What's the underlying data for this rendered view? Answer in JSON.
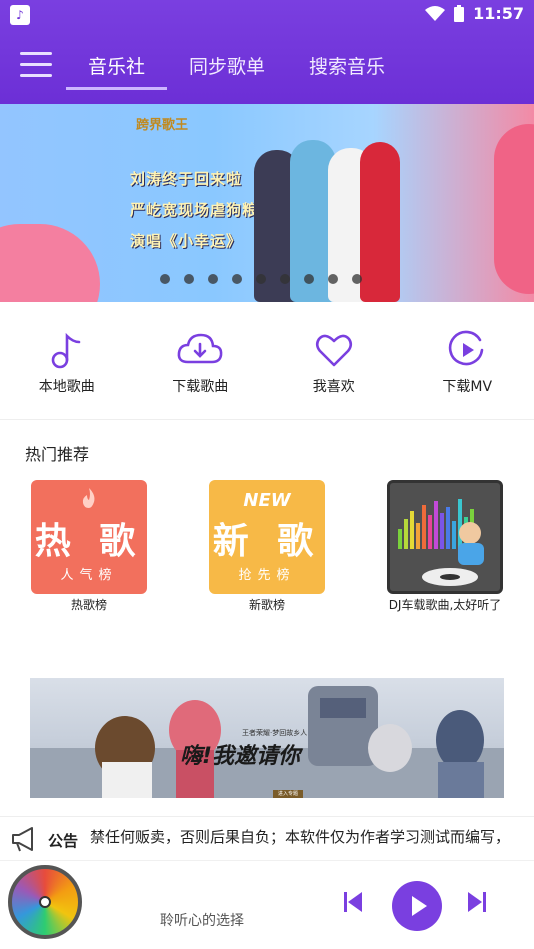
{
  "colors": {
    "primary": "#6c2fd6",
    "accent": "#7a3fe0",
    "hot_card": "#f2705d",
    "new_card": "#f7b947"
  },
  "status": {
    "time": "11:57",
    "icons": [
      "app-icon",
      "wifi-icon",
      "battery-icon"
    ]
  },
  "tabs": [
    {
      "label": "音乐社",
      "active": true
    },
    {
      "label": "同步歌单",
      "active": false
    },
    {
      "label": "搜索音乐",
      "active": false
    }
  ],
  "banner": {
    "logo": "跨界歌王",
    "lines": [
      "刘涛终于回来啦",
      "严屹宽现场虐狗粮",
      "演唱《小幸运》"
    ],
    "dot_count": 9
  },
  "quick": [
    {
      "label": "本地歌曲",
      "icon": "music-note-icon"
    },
    {
      "label": "下载歌曲",
      "icon": "cloud-download-icon"
    },
    {
      "label": "我喜欢",
      "icon": "heart-icon"
    },
    {
      "label": "下载MV",
      "icon": "play-circle-icon"
    }
  ],
  "hot": {
    "title": "热门推荐",
    "cards": [
      {
        "label": "热歌榜",
        "big": "热 歌",
        "sub": "人气榜"
      },
      {
        "label": "新歌榜",
        "big": "新 歌",
        "sub": "抢先榜",
        "tag": "NEW"
      },
      {
        "label": "DJ车载歌曲,太好听了"
      }
    ]
  },
  "game_banner": {
    "title": "嗨!我邀请你",
    "sub": "王者荣耀·梦回故乡人",
    "button": "进入专题"
  },
  "notice": {
    "label": "公告",
    "text": "禁任何贩卖，否则后果自负；本软件仅为作者学习测试而编写，"
  },
  "player": {
    "song": "聆听心的选择"
  }
}
